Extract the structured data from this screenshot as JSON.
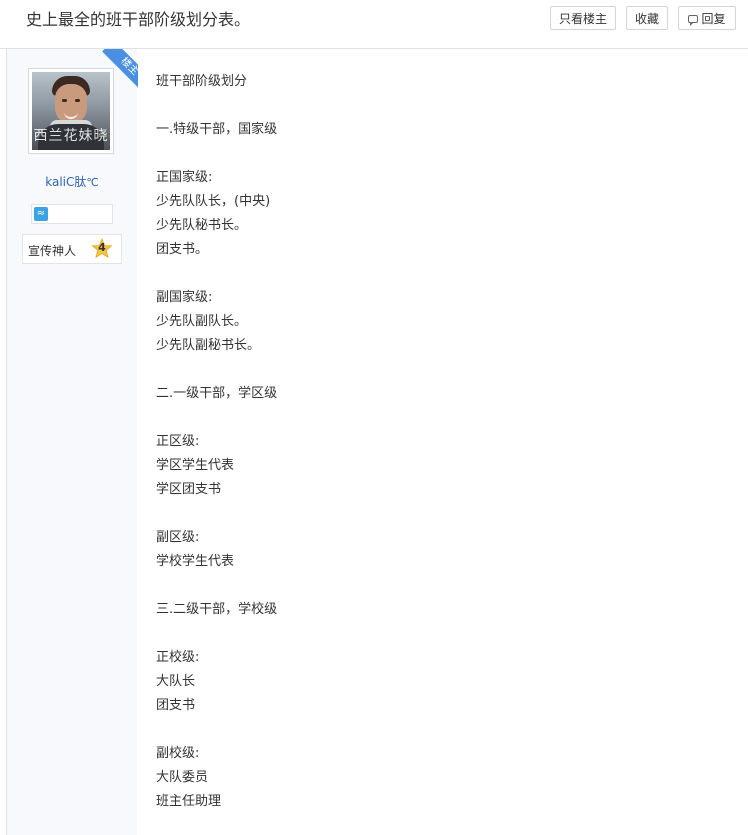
{
  "header": {
    "title": "史上最全的班干部阶级划分表。",
    "only_op_label": "只看楼主",
    "favorite_label": "收藏",
    "reply_label": "回复"
  },
  "author": {
    "op_tag": "楼主",
    "avatar_watermark": "西兰花妹晓",
    "username": "kaliC肽",
    "username_suffix": "℃",
    "level_name": "宣传神人",
    "level_number": "4"
  },
  "post": {
    "lines": [
      "班干部阶级划分",
      "",
      "一.特级干部，国家级",
      "",
      "正国家级:",
      "少先队队长，(中央)",
      "少先队秘书长。",
      "团支书。",
      "",
      "副国家级:",
      "少先队副队长。",
      "少先队副秘书长。",
      "",
      "二.一级干部，学区级",
      "",
      "正区级:",
      "学区学生代表",
      "学区团支书",
      "",
      "副区级:",
      "学校学生代表",
      "",
      "三.二级干部，学校级",
      "",
      "正校级:",
      "大队长",
      "团支书",
      "",
      "副校级:",
      "大队委员",
      "班主任助理"
    ]
  },
  "colors": {
    "accent_blue": "#4a90e2",
    "username_blue": "#2d64b3",
    "sidebar_bg": "#f7f9fd",
    "level_star": "#f5c542"
  }
}
